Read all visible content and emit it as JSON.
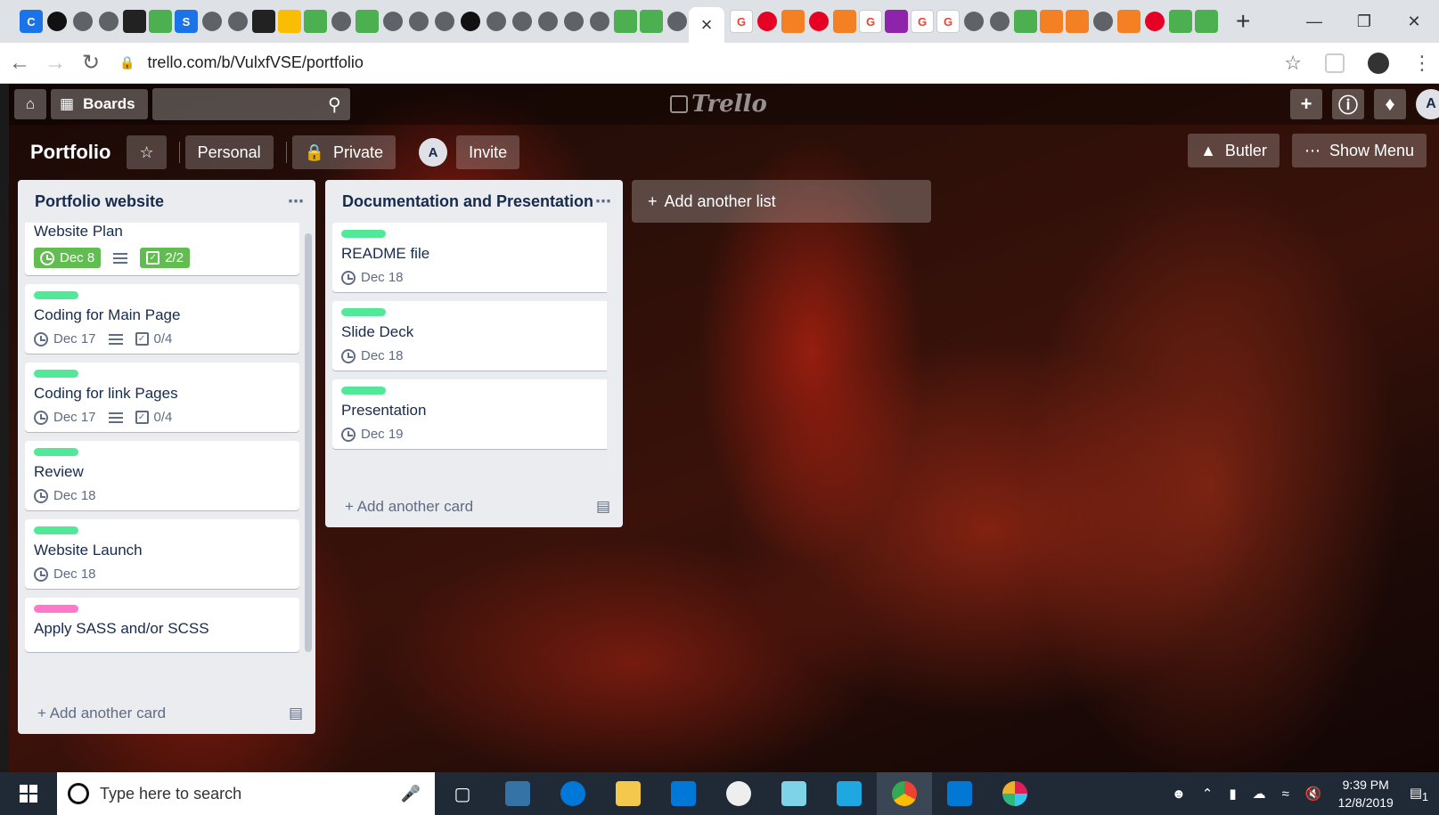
{
  "browser": {
    "url": "trello.com/b/VulxfVSE/portfolio",
    "active_tab_close": "×",
    "new_tab": "+"
  },
  "trello": {
    "boards_label": "Boards",
    "logo_text": "Trello",
    "member_initial": "A",
    "board": {
      "title": "Portfolio",
      "team_label": "Personal",
      "visibility_label": "Private",
      "invite_label": "Invite",
      "butler_label": "Butler",
      "show_menu_label": "Show Menu"
    },
    "lists": [
      {
        "title": "Portfolio website",
        "add_card_label": "Add another card",
        "cards": [
          {
            "title": "Website Plan",
            "label_color": "green",
            "due": "Dec 8",
            "due_complete": true,
            "has_description": true,
            "checklist": "2/2",
            "checklist_complete": true
          },
          {
            "title": "Coding for Main Page",
            "label_color": "green",
            "due": "Dec 17",
            "has_description": true,
            "checklist": "0/4"
          },
          {
            "title": "Coding for link Pages",
            "label_color": "green",
            "due": "Dec 17",
            "has_description": true,
            "checklist": "0/4"
          },
          {
            "title": "Review",
            "label_color": "green",
            "due": "Dec 18"
          },
          {
            "title": "Website Launch",
            "label_color": "green",
            "due": "Dec 18"
          },
          {
            "title": "Apply SASS and/or SCSS",
            "label_color": "pink"
          }
        ]
      },
      {
        "title": "Documentation and Presentation",
        "add_card_label": "Add another card",
        "cards": [
          {
            "title": "README file",
            "label_color": "green",
            "due": "Dec 18"
          },
          {
            "title": "Slide Deck",
            "label_color": "green",
            "due": "Dec 18"
          },
          {
            "title": "Presentation",
            "label_color": "green",
            "due": "Dec 19"
          }
        ]
      }
    ],
    "add_list_label": "Add another list"
  },
  "taskbar": {
    "search_placeholder": "Type here to search",
    "time": "9:39 PM",
    "date": "12/8/2019",
    "notification_count": "1"
  },
  "colors": {
    "label_green": "#51e898",
    "label_pink": "#ff78cb",
    "badge_complete": "#61bd4f"
  }
}
